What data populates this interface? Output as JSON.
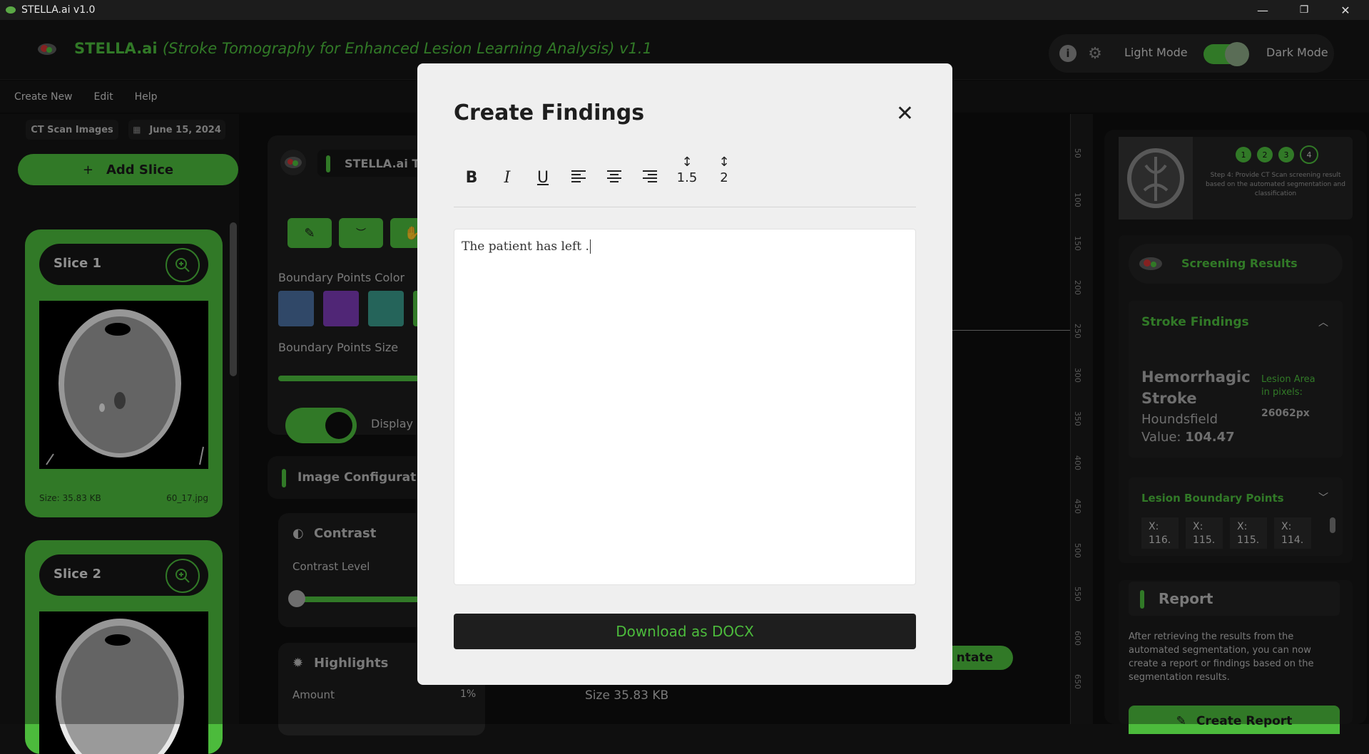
{
  "window": {
    "title": "STELLA.ai v1.0",
    "controls": [
      "—",
      "❐",
      "✕"
    ]
  },
  "header": {
    "brand": "STELLA.ai",
    "subtitle": "(Stroke Tomography for Enhanced Lesion Learning Analysis) v1.1",
    "light_mode": "Light Mode",
    "dark_mode": "Dark Mode",
    "info_glyph": "i",
    "gear_glyph": "⚙"
  },
  "menu": [
    "Create New",
    "Edit",
    "Help"
  ],
  "left": {
    "chip_images": "CT Scan Images",
    "chip_date": "June 15, 2024",
    "add_slice": "Add Slice",
    "slices": [
      {
        "name": "Slice 1",
        "size": "Size: 35.83 KB",
        "file": "60_17.jpg"
      },
      {
        "name": "Slice 2"
      }
    ]
  },
  "tools": {
    "heading": "STELLA.ai T",
    "boundary_color_label": "Boundary Points Color",
    "boundary_size_label": "Boundary Points Size",
    "display_label": "Display S",
    "image_config": "Image Configurat",
    "contrast": "Contrast",
    "contrast_level": "Contrast Level",
    "highlights": "Highlights",
    "amount": "Amount",
    "amount_value": "1%",
    "swatch_colors": [
      "#4a6fa0",
      "#7b3bb5",
      "#3a9a8a",
      "#4cbb3c"
    ],
    "boundary_size_fraction": 0.87
  },
  "center": {
    "annotate_partial": "ntate",
    "size_text": "Size 35.83 KB"
  },
  "ruler": [
    "50",
    "100",
    "150",
    "200",
    "250",
    "300",
    "350",
    "400",
    "450",
    "500",
    "550",
    "600",
    "650"
  ],
  "right": {
    "steps": [
      "1",
      "2",
      "3",
      "4"
    ],
    "step_text": "Step 4: Provide CT Scan screening result based on the automated segmentation and classification",
    "screening_results": "Screening Results",
    "stroke_findings": "Stroke Findings",
    "stroke_type": "Hemorrhagic Stroke",
    "houndsfield_label": "Houndsfield Value:",
    "houndsfield_value": "104.47",
    "lesion_area_label": "Lesion Area in pixels:",
    "lesion_area_value": "26062px",
    "lesion_boundary_points": "Lesion Boundary Points",
    "points": [
      "X: 116.",
      "X: 115.",
      "X: 115.",
      "X: 114."
    ],
    "report": "Report",
    "report_text": "After retrieving the results from the automated segmentation, you can now create a report or findings based on the segmentation results.",
    "create_report": "Create Report"
  },
  "modal": {
    "title": "Create Findings",
    "close": "✕",
    "toolbar": {
      "bold": "B",
      "italic": "I",
      "underline": "U",
      "spacing_15": "1.5",
      "spacing_2": "2"
    },
    "content": "The patient has left .",
    "download": "Download as DOCX"
  }
}
